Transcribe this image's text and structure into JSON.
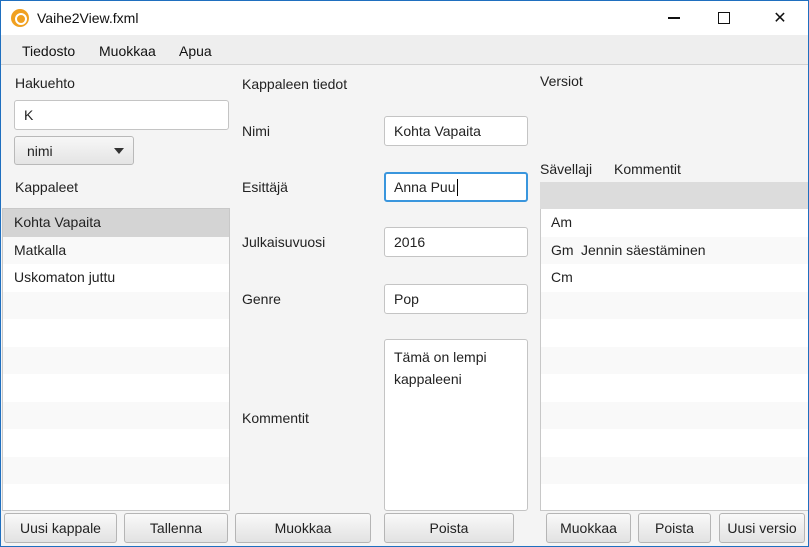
{
  "window": {
    "title": "Vaihe2View.fxml",
    "minimize_glyph": "",
    "close_glyph": "✕"
  },
  "menu": {
    "items": [
      "Tiedosto",
      "Muokkaa",
      "Apua"
    ]
  },
  "search": {
    "label": "Hakuehto",
    "value": "K",
    "field_combo": "nimi"
  },
  "songs": {
    "label": "Kappaleet",
    "items": [
      "Kohta Vapaita",
      "Matkalla",
      "Uskomaton juttu"
    ],
    "selected_index": 0
  },
  "details": {
    "heading": "Kappaleen tiedot",
    "name_label": "Nimi",
    "name_value": "Kohta Vapaita",
    "artist_label": "Esittäjä",
    "artist_value": "Anna Puu",
    "year_label": "Julkaisuvuosi",
    "year_value": "2016",
    "genre_label": "Genre",
    "genre_value": "Pop",
    "comments_label": "Kommentit",
    "comments_value": "Tämä on lempi\nkappaleeni"
  },
  "versions": {
    "label": "Versiot",
    "col_key": "Sävellaji",
    "col_comment": "Kommentit",
    "rows": [
      {
        "key": "Am",
        "comment": ""
      },
      {
        "key": "Gm",
        "comment": "Jennin säestäminen"
      },
      {
        "key": "Cm",
        "comment": ""
      }
    ]
  },
  "buttons": {
    "new_song": "Uusi kappale",
    "save": "Tallenna",
    "edit_song": "Muokkaa",
    "delete_song": "Poista",
    "edit_version": "Muokkaa",
    "delete_version": "Poista",
    "new_version": "Uusi versio"
  },
  "colors": {
    "focus_border": "#3a96dd",
    "selection": "#d4d4d4",
    "app_icon": "#f0a020"
  }
}
